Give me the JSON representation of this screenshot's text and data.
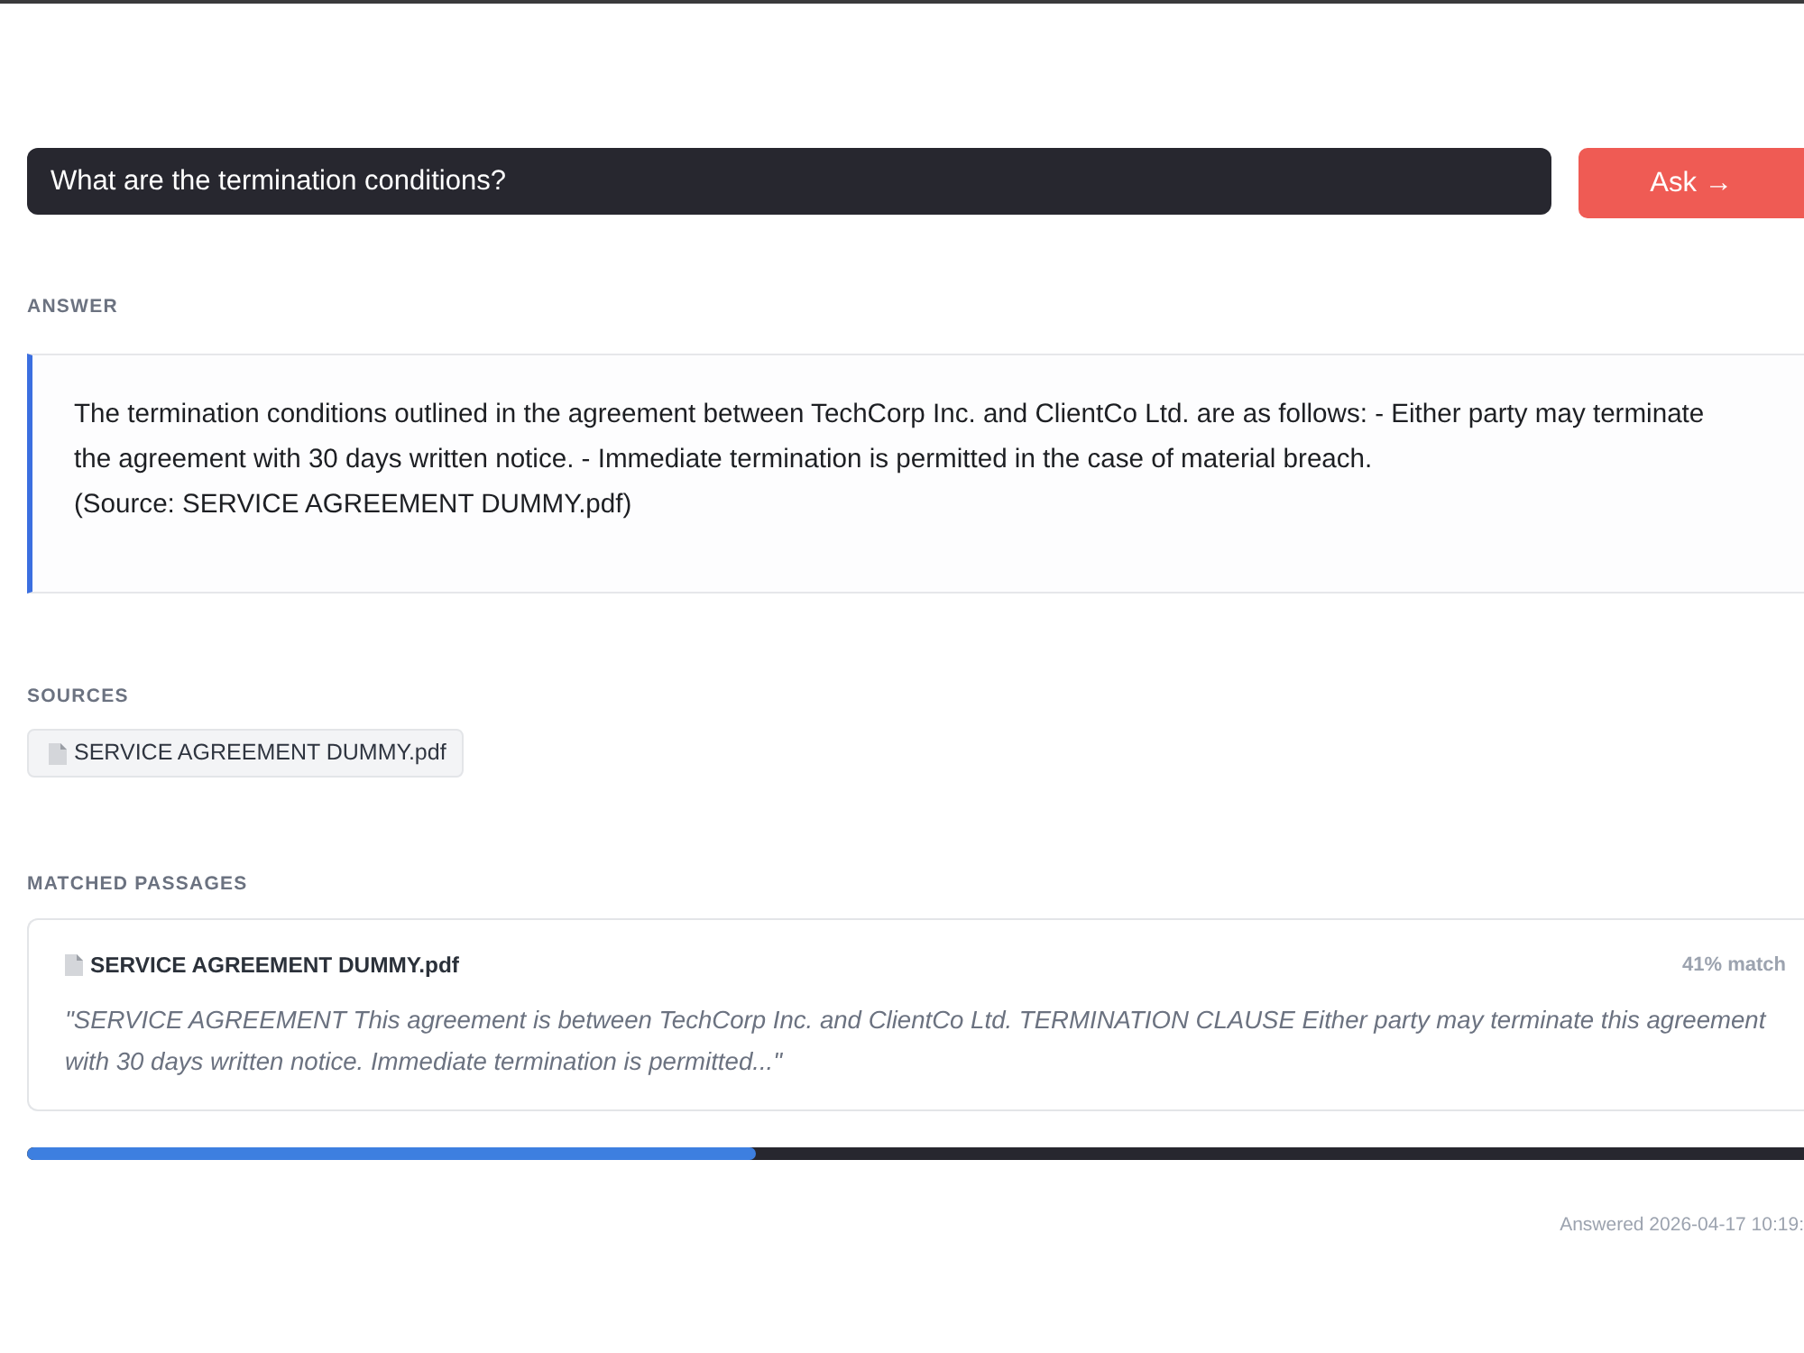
{
  "question": {
    "value": "What are the termination conditions?"
  },
  "ask_button": {
    "label": "Ask →"
  },
  "answer": {
    "heading": "ANSWER",
    "text": "The termination conditions outlined in the agreement between TechCorp Inc. and ClientCo Ltd. are as follows: - Either party may terminate the agreement with 30 days written notice. - Immediate termination is permitted in the case of material breach.\n(Source: SERVICE AGREEMENT DUMMY.pdf)"
  },
  "sources": {
    "heading": "SOURCES",
    "items": [
      {
        "label": "SERVICE AGREEMENT DUMMY.pdf"
      }
    ]
  },
  "matched_passages": {
    "heading": "MATCHED PASSAGES",
    "items": [
      {
        "file": "SERVICE AGREEMENT DUMMY.pdf",
        "match": "41% match",
        "quote": "\"SERVICE AGREEMENT This agreement is between TechCorp Inc. and ClientCo Ltd. TERMINATION CLAUSE Either party may terminate this agreement with 30 days written notice. Immediate termination is permitted...\""
      }
    ]
  },
  "progress": {
    "level": 0.41
  },
  "status": {
    "answered": "Answered 2026-04-17 10:19:"
  }
}
